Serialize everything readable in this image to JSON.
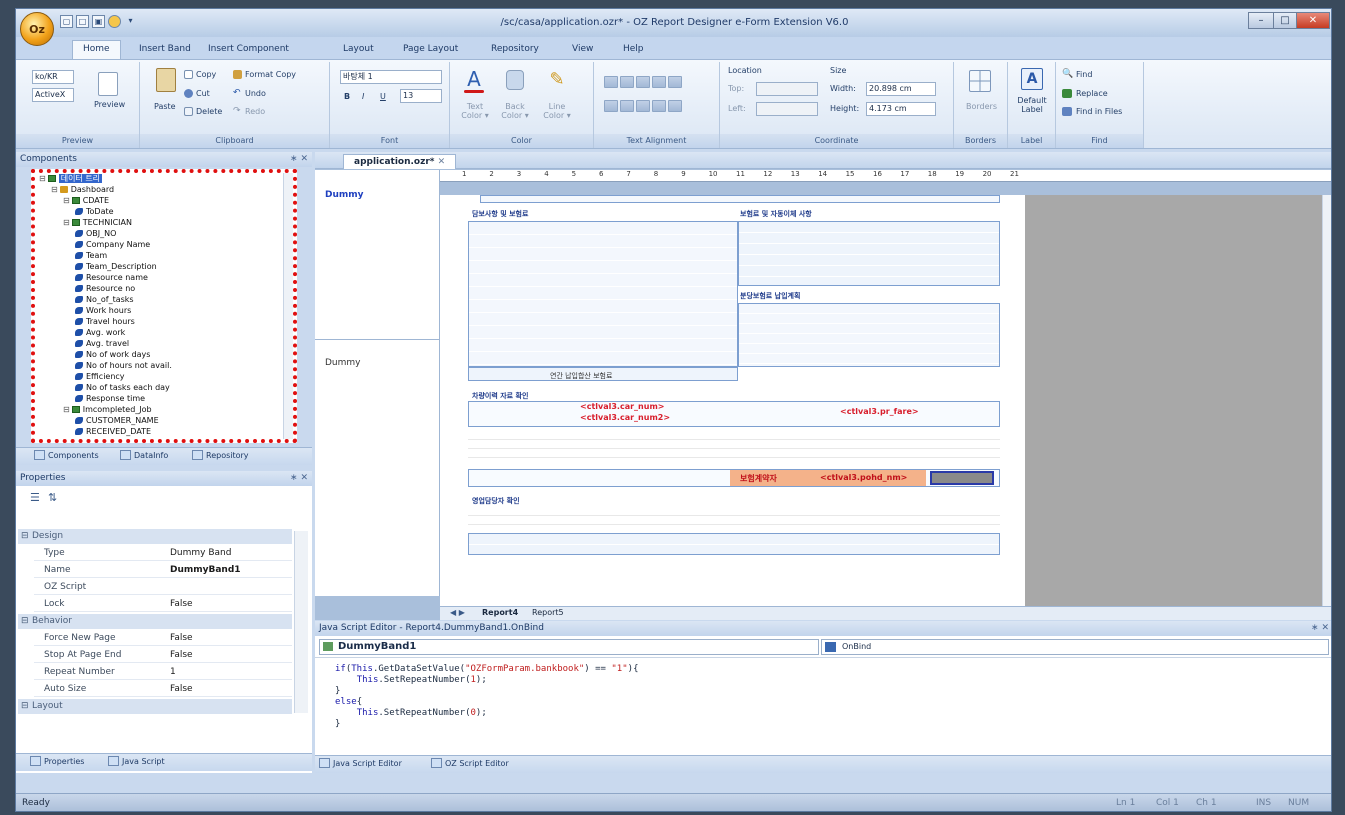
{
  "window": {
    "title": "/sc/casa/application.ozr* - OZ Report Designer e-Form Extension V6.0",
    "logo": "Oz",
    "min": "–",
    "max": "□",
    "close": "✕"
  },
  "tabs": [
    "Home",
    "Insert Band",
    "Insert Component",
    "Layout",
    "Page Layout",
    "Repository",
    "View",
    "Help"
  ],
  "ribbon": {
    "preview": {
      "lang": "ko/KR",
      "mode": "ActiveX",
      "button": "Preview",
      "label": "Preview"
    },
    "clipboard": {
      "paste": "Paste",
      "copy": "Copy",
      "format_copy": "Format Copy",
      "cut": "Cut",
      "undo": "Undo",
      "delete": "Delete",
      "redo": "Redo",
      "label": "Clipboard"
    },
    "font": {
      "name": "바탕체 1",
      "bold": "B",
      "italic": "I",
      "underline": "U",
      "size": "13",
      "label": "Font"
    },
    "color": {
      "text": "Text Color ▾",
      "back": "Back Color ▾",
      "line": "Line Color ▾",
      "label": "Color"
    },
    "align": {
      "label": "Text Alignment"
    },
    "coord": {
      "location": "Location",
      "top": "Top:",
      "left": "Left:",
      "size": "Size",
      "width_label": "Width:",
      "width": "20.898 cm",
      "height_label": "Height:",
      "height": "4.173 cm",
      "label": "Coordinate"
    },
    "borders": {
      "button": "Borders",
      "label": "Borders"
    },
    "deflabel": {
      "button": "Default Label",
      "label": "Label"
    },
    "find": {
      "find": "Find",
      "replace": "Replace",
      "files": "Find in Files",
      "label": "Find"
    }
  },
  "components": {
    "title": "Components",
    "tree": [
      {
        "label": "데이터 트리",
        "level": 0,
        "kind": "root"
      },
      {
        "label": "Dashboard",
        "level": 1,
        "kind": "db"
      },
      {
        "label": "CDATE",
        "level": 2,
        "kind": "table"
      },
      {
        "label": "ToDate",
        "level": 3,
        "kind": "field"
      },
      {
        "label": "TECHNICIAN",
        "level": 2,
        "kind": "table"
      },
      {
        "label": "OBJ_NO",
        "level": 3,
        "kind": "field"
      },
      {
        "label": "Company Name",
        "level": 3,
        "kind": "field"
      },
      {
        "label": "Team",
        "level": 3,
        "kind": "field"
      },
      {
        "label": "Team_Description",
        "level": 3,
        "kind": "field"
      },
      {
        "label": "Resource name",
        "level": 3,
        "kind": "field"
      },
      {
        "label": "Resource no",
        "level": 3,
        "kind": "field"
      },
      {
        "label": "No_of_tasks",
        "level": 3,
        "kind": "field"
      },
      {
        "label": "Work hours",
        "level": 3,
        "kind": "field"
      },
      {
        "label": "Travel hours",
        "level": 3,
        "kind": "field"
      },
      {
        "label": "Avg. work",
        "level": 3,
        "kind": "field"
      },
      {
        "label": "Avg. travel",
        "level": 3,
        "kind": "field"
      },
      {
        "label": "No of work days",
        "level": 3,
        "kind": "field"
      },
      {
        "label": "No of hours not avail.",
        "level": 3,
        "kind": "field"
      },
      {
        "label": "Efficiency",
        "level": 3,
        "kind": "field"
      },
      {
        "label": "No of tasks each day",
        "level": 3,
        "kind": "field"
      },
      {
        "label": "Response time",
        "level": 3,
        "kind": "field"
      },
      {
        "label": "Imcompleted_Job",
        "level": 2,
        "kind": "table"
      },
      {
        "label": "CUSTOMER_NAME",
        "level": 3,
        "kind": "field"
      },
      {
        "label": "RECEIVED_DATE",
        "level": 3,
        "kind": "field"
      }
    ],
    "tabs": [
      "Components",
      "DataInfo",
      "Repository"
    ]
  },
  "properties": {
    "title": "Properties",
    "rows": [
      {
        "cat": "Design"
      },
      {
        "k": "Type",
        "v": "Dummy Band"
      },
      {
        "k": "Name",
        "v": "DummyBand1"
      },
      {
        "k": "OZ Script",
        "v": ""
      },
      {
        "k": "Lock",
        "v": "False"
      },
      {
        "cat": "Behavior"
      },
      {
        "k": "Force New Page",
        "v": "False"
      },
      {
        "k": "Stop At Page End",
        "v": "False"
      },
      {
        "k": "Repeat Number",
        "v": "1"
      },
      {
        "k": "Auto Size",
        "v": "False"
      },
      {
        "cat": "Layout"
      }
    ],
    "tabs": [
      "Properties",
      "Java Script"
    ]
  },
  "document": {
    "tab": "application.ozr*",
    "bands": [
      "Dummy",
      "Dummy"
    ],
    "report_tabs": [
      "Report4",
      "Report5"
    ],
    "ruler": [
      "1",
      "2",
      "3",
      "4",
      "5",
      "6",
      "7",
      "8",
      "9",
      "10",
      "11",
      "12",
      "13",
      "14",
      "15",
      "16",
      "17",
      "18",
      "19",
      "20",
      "21"
    ],
    "red": [
      "<ctlval3.car_num>",
      "<ctlval3.car_num2>",
      "<ctlval3.pr_fare>",
      "보험계약자",
      "<ctlval3.pohd_nm>"
    ],
    "sections": [
      "담보사항 및 보험료",
      "보험료 및 자동이체 사항",
      "분당보험료 납입계획",
      "차량이력 자료 확인",
      "영업담당자 확인"
    ],
    "summary": "연간 납입합산 보험료"
  },
  "jse": {
    "title": "Java Script Editor - Report4.DummyBand1.OnBind",
    "object": "DummyBand1",
    "event": "OnBind",
    "tabs": [
      "Java Script Editor",
      "OZ Script Editor"
    ]
  },
  "status": {
    "left": "Ready",
    "ln": "Ln 1",
    "col": "Col 1",
    "ch": "Ch 1",
    "ins": "INS",
    "num": "NUM"
  }
}
